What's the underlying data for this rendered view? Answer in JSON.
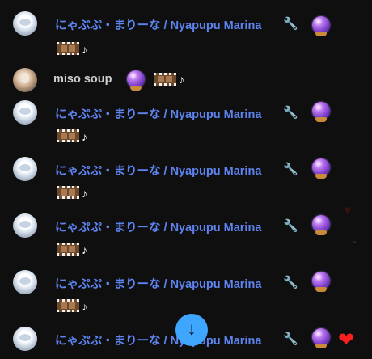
{
  "chat": {
    "messages": [
      {
        "author": "にゃぷぷ・まりーな / Nyapupu Marina",
        "member": true,
        "avatar": "marina-avatar",
        "emojis": [
          "crystal-ball",
          "film-strip",
          "music-note"
        ],
        "note": "♪"
      },
      {
        "author": "miso soup",
        "member": false,
        "avatar": "miso-avatar",
        "emojis": [
          "crystal-ball",
          "film-strip",
          "music-note"
        ],
        "note": "♪"
      },
      {
        "author": "にゃぷぷ・まりーな / Nyapupu Marina",
        "member": true,
        "avatar": "marina-avatar",
        "emojis": [
          "crystal-ball",
          "film-strip",
          "music-note"
        ],
        "note": "♪"
      },
      {
        "author": "にゃぷぷ・まりーな / Nyapupu Marina",
        "member": true,
        "avatar": "marina-avatar",
        "emojis": [
          "crystal-ball",
          "film-strip",
          "music-note"
        ],
        "note": "♪"
      },
      {
        "author": "にゃぷぷ・まりーな / Nyapupu Marina",
        "member": true,
        "avatar": "marina-avatar",
        "emojis": [
          "crystal-ball",
          "film-strip",
          "music-note"
        ],
        "note": "♪"
      },
      {
        "author": "にゃぷぷ・まりーな / Nyapupu Marina",
        "member": true,
        "avatar": "marina-avatar",
        "emojis": [
          "crystal-ball",
          "film-strip",
          "music-note"
        ],
        "note": "♪"
      },
      {
        "author": "にゃぷぷ・まりーな / Nyapupu Marina",
        "member": true,
        "avatar": "marina-avatar",
        "emojis": [
          "crystal-ball"
        ]
      }
    ],
    "moderator_badge_icon": "wrench-icon",
    "scroll_button_icon": "arrow-down-icon",
    "reaction_icon": "heart-icon",
    "colors": {
      "member_name": "#5e84f1",
      "normal_name": "#cfcfcf",
      "fab": "#3ea6ff",
      "heart": "#ff1e1e",
      "background": "#0f0f0f"
    }
  }
}
